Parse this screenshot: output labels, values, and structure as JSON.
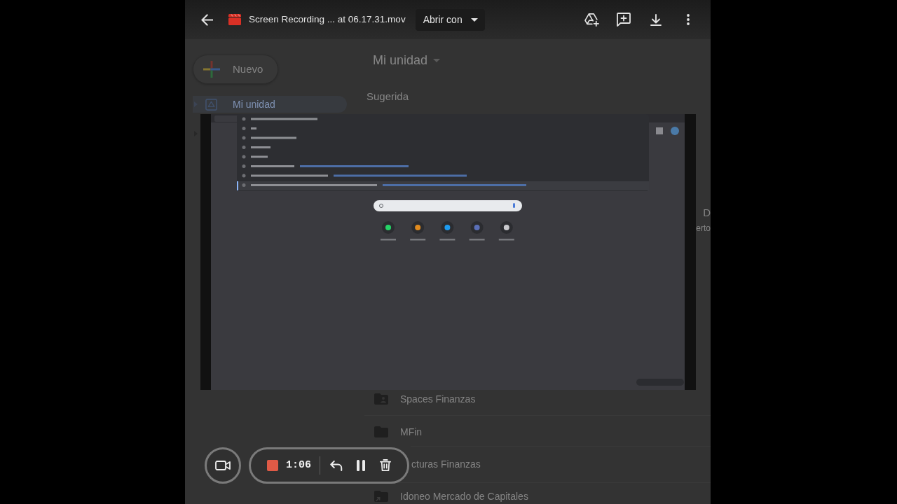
{
  "viewer": {
    "title": "Screen Recording ... at 06.17.31.mov",
    "open_with": "Abrir con"
  },
  "drive": {
    "new_button": "Nuevo",
    "sidebar_items": [
      {
        "label": "Mi unidad",
        "selected": true,
        "expanded": false
      },
      {
        "selected": false,
        "expanded": false
      }
    ],
    "heading": "Mi unidad",
    "section": "Sugerida",
    "edge_fragments": [
      "D",
      "erto"
    ],
    "folders": [
      {
        "name": "Spaces Finanzas",
        "kind": "shared"
      },
      {
        "name": "MFin",
        "kind": "folder"
      },
      {
        "name": "cturas Finanzas",
        "kind": "covered"
      },
      {
        "name": "Idoneo Mercado de Capitales",
        "kind": "shortcut"
      }
    ]
  },
  "recorder": {
    "elapsed": "1:06"
  }
}
